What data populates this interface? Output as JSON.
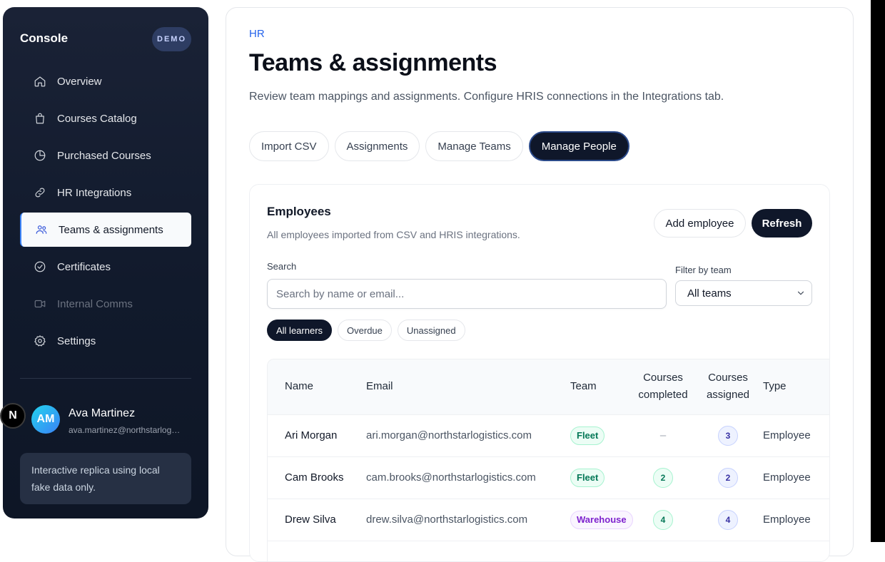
{
  "sidebar": {
    "brand": "Console",
    "badge": "DEMO",
    "items": [
      {
        "label": "Overview",
        "icon": "home-icon"
      },
      {
        "label": "Courses Catalog",
        "icon": "shopping-bag-icon"
      },
      {
        "label": "Purchased Courses",
        "icon": "pie-chart-icon"
      },
      {
        "label": "HR Integrations",
        "icon": "link-icon"
      },
      {
        "label": "Teams & assignments",
        "icon": "users-icon",
        "active": true
      },
      {
        "label": "Certificates",
        "icon": "check-circle-icon"
      },
      {
        "label": "Internal Comms",
        "icon": "video-icon",
        "disabled": true
      },
      {
        "label": "Settings",
        "icon": "gear-icon"
      }
    ],
    "user": {
      "initials": "AM",
      "name": "Ava Martinez",
      "email": "ava.martinez@northstarlogistics.com"
    },
    "n_badge": "N",
    "note": "Interactive replica using local fake data only."
  },
  "main": {
    "breadcrumb": "HR",
    "title": "Teams & assignments",
    "description": "Review team mappings and assignments. Configure HRIS connections in the Integrations tab.",
    "tabs": [
      "Import CSV",
      "Assignments",
      "Manage Teams",
      "Manage People"
    ],
    "active_tab": "Manage People"
  },
  "employees": {
    "title": "Employees",
    "description": "All employees imported from CSV and HRIS integrations.",
    "add_label": "Add employee",
    "refresh_label": "Refresh",
    "search_label": "Search",
    "search_placeholder": "Search by name or email...",
    "filter_label": "Filter by team",
    "filter_value": "All teams",
    "chips": [
      "All learners",
      "Overdue",
      "Unassigned"
    ],
    "columns": {
      "name": "Name",
      "email": "Email",
      "team": "Team",
      "completed": "Courses completed",
      "assigned": "Courses assigned",
      "type": "Type"
    },
    "rows": [
      {
        "name": "Ari Morgan",
        "email": "ari.morgan@northstarlogistics.com",
        "team": "Fleet",
        "completed": "–",
        "assigned": "3",
        "type": "Employee"
      },
      {
        "name": "Cam Brooks",
        "email": "cam.brooks@northstarlogistics.com",
        "team": "Fleet",
        "completed": "2",
        "assigned": "2",
        "type": "Employee"
      },
      {
        "name": "Drew Silva",
        "email": "drew.silva@northstarlogistics.com",
        "team": "Warehouse",
        "completed": "4",
        "assigned": "4",
        "type": "Employee"
      }
    ]
  },
  "colors": {
    "accent": "#2563eb",
    "dark": "#0f172a",
    "sidebar": "#141c2e"
  }
}
